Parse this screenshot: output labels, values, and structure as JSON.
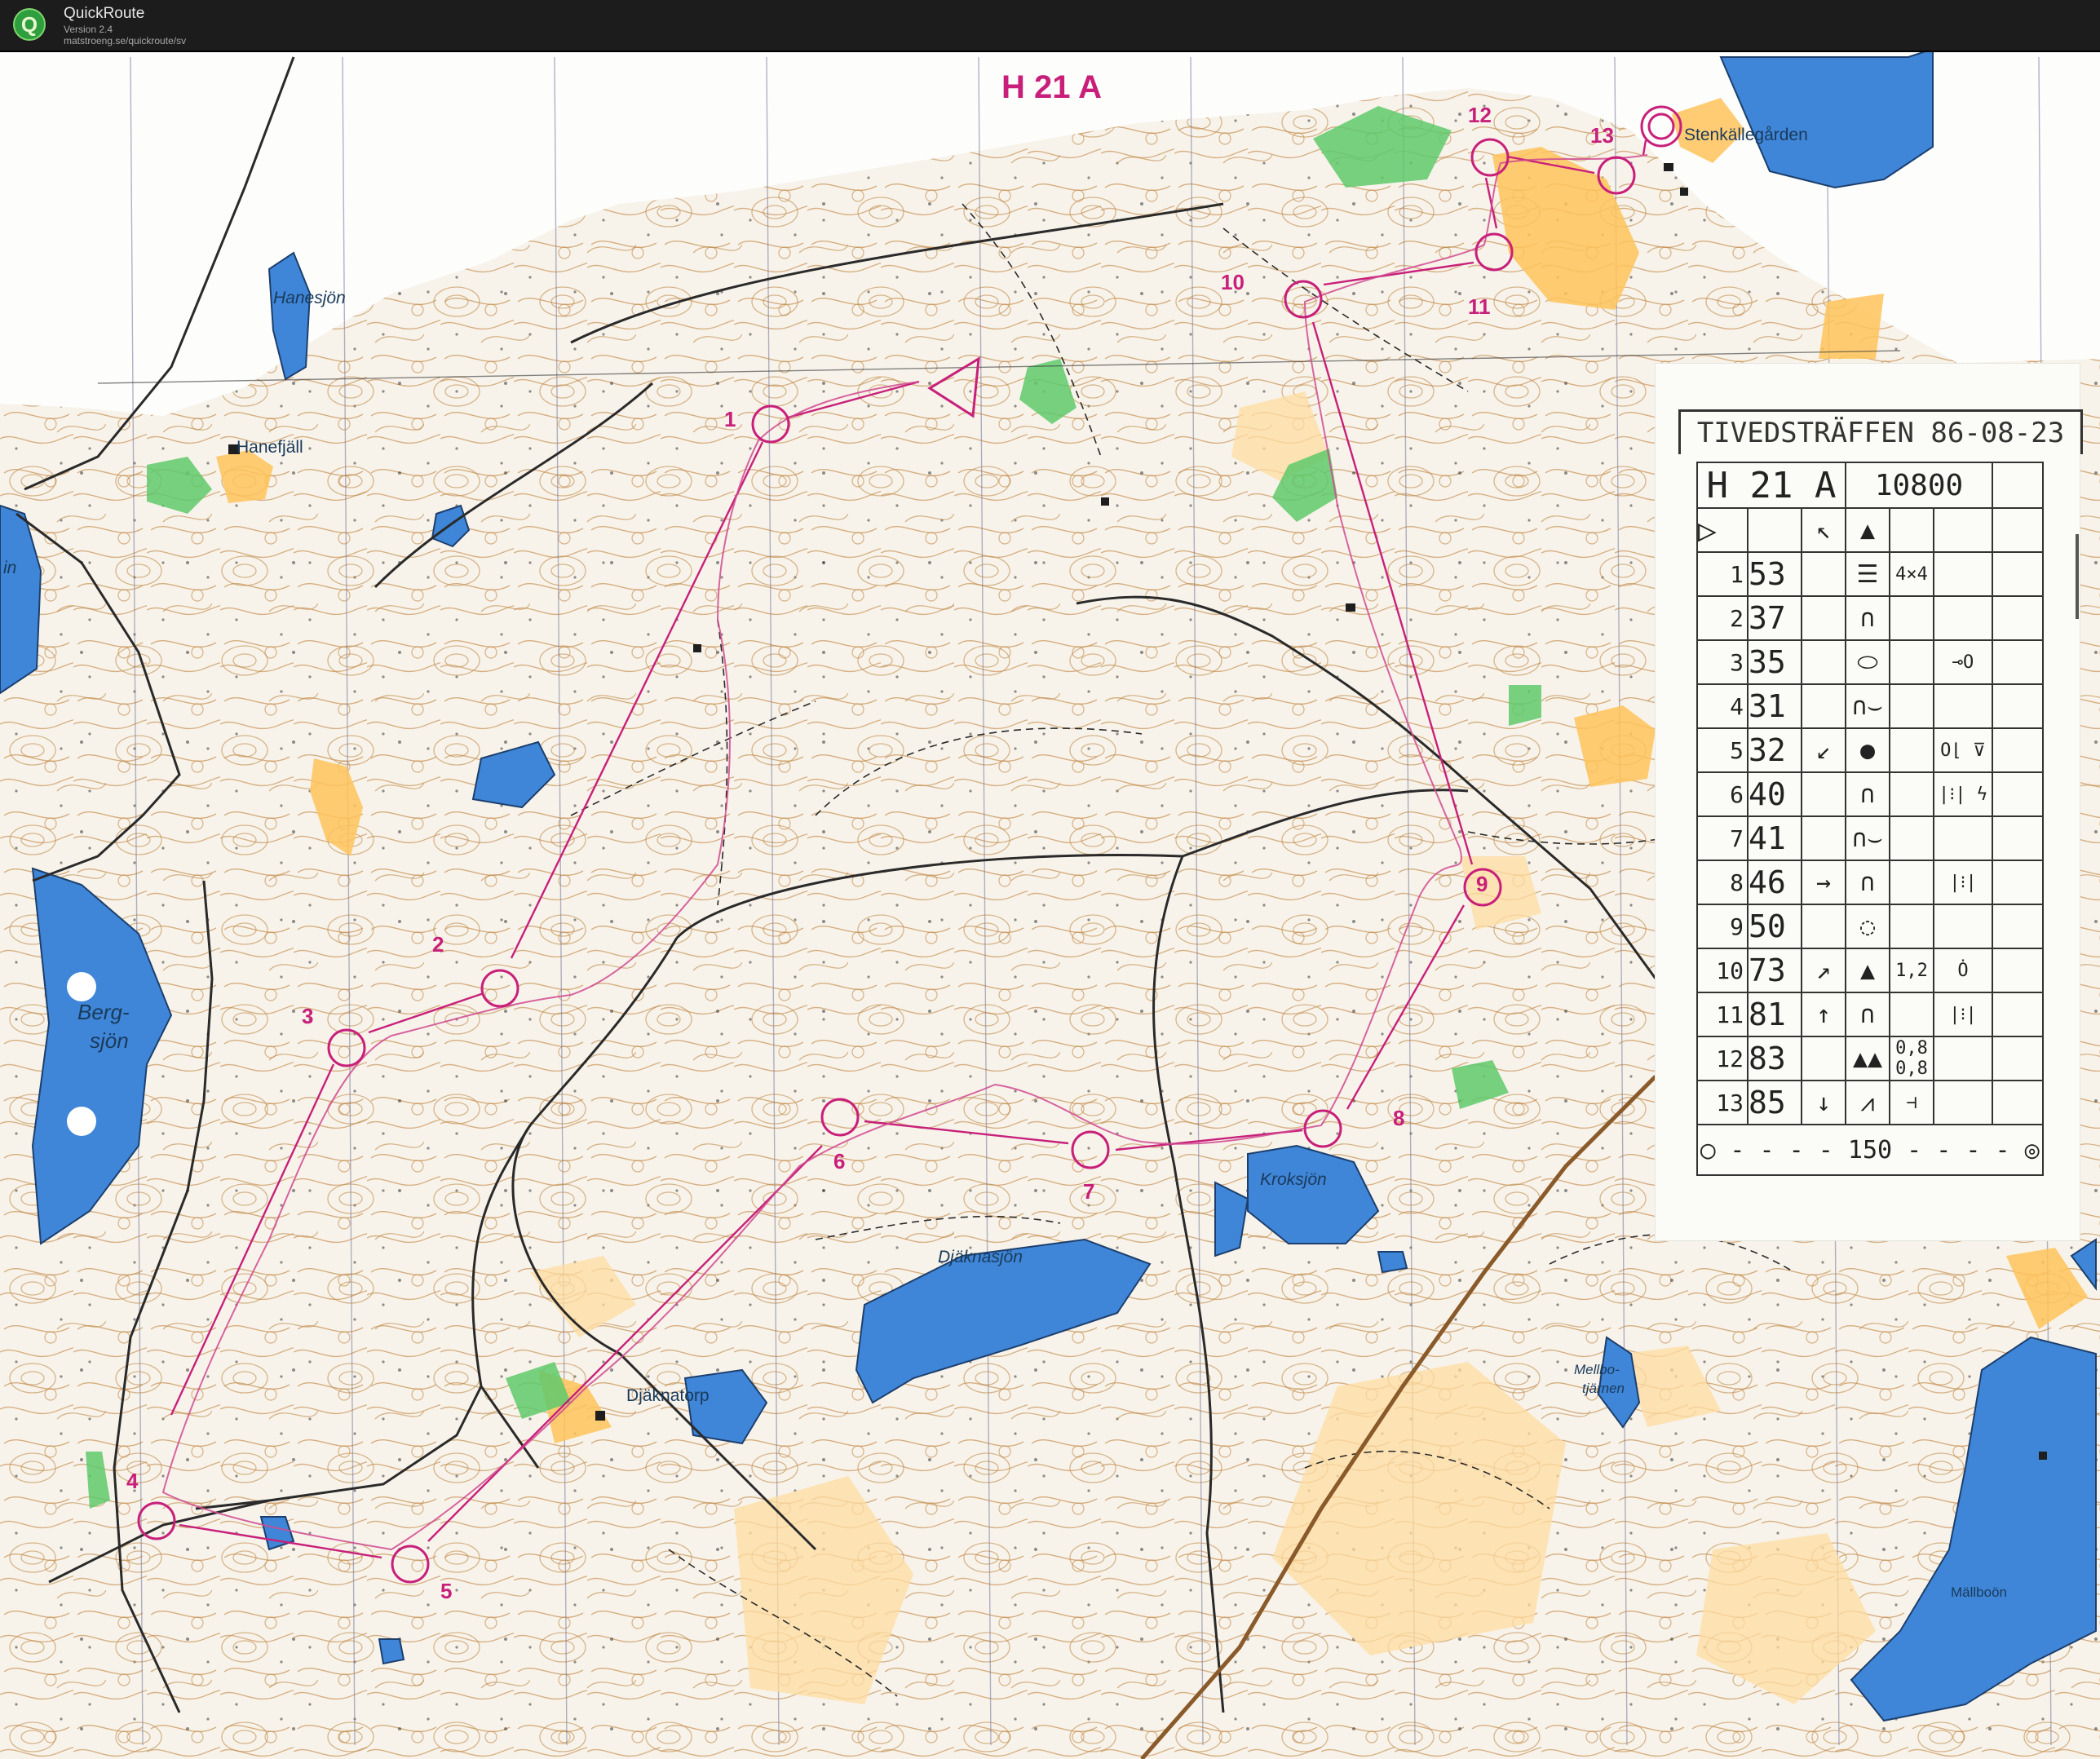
{
  "app": {
    "title": "QuickRoute",
    "version": "Version 2.4",
    "url": "matstroeng.se/quickroute/sv"
  },
  "map": {
    "course_title": "H 21 A",
    "place_names": {
      "hanesjon": "Hanesjön",
      "hanefjall": "Hanefjäll",
      "bergsjon_1": "Berg-",
      "bergsjon_2": "sjön",
      "in": "in",
      "stenkallegarden": "Stenkällegården",
      "kroksjon": "Kroksjön",
      "djaknasjon": "Djäknasjön",
      "djaknatorp": "Djäknatorp",
      "mellbotjarnen_1": "Mellbo-",
      "mellbotjarnen_2": "tjärnen",
      "mallboon": "Mällboön"
    },
    "controls": [
      "1",
      "2",
      "3",
      "4",
      "5",
      "6",
      "7",
      "8",
      "9",
      "10",
      "11",
      "12",
      "13"
    ]
  },
  "description_sheet": {
    "event_title": "TIVEDSTRÄFFEN 86-08-23",
    "course": "H 21 A",
    "distance": "10800",
    "start_symbols": [
      "▷",
      "↖",
      "▲"
    ],
    "rows": [
      {
        "n": "1",
        "code": "53",
        "dir": "",
        "feature": "☰",
        "extra": "4×4",
        "extra2": ""
      },
      {
        "n": "2",
        "code": "37",
        "dir": "",
        "feature": "∩",
        "extra": "",
        "extra2": ""
      },
      {
        "n": "3",
        "code": "35",
        "dir": "",
        "feature": "⬭",
        "extra": "",
        "extra2": "⊸O"
      },
      {
        "n": "4",
        "code": "31",
        "dir": "",
        "feature": "∩⌣",
        "extra": "",
        "extra2": ""
      },
      {
        "n": "5",
        "code": "32",
        "dir": "↙",
        "feature": "●",
        "extra": "",
        "extra2": "O⌊ ⊽"
      },
      {
        "n": "6",
        "code": "40",
        "dir": "",
        "feature": "∩",
        "extra": "",
        "extra2": "|⁝| ϟ"
      },
      {
        "n": "7",
        "code": "41",
        "dir": "",
        "feature": "∩⌣",
        "extra": "",
        "extra2": ""
      },
      {
        "n": "8",
        "code": "46",
        "dir": "→",
        "feature": "∩",
        "extra": "",
        "extra2": "|⁝|"
      },
      {
        "n": "9",
        "code": "50",
        "dir": "",
        "feature": "◌",
        "extra": "",
        "extra2": ""
      },
      {
        "n": "10",
        "code": "73",
        "dir": "↗",
        "feature": "▲",
        "extra": "1,2",
        "extra2": "Ȯ"
      },
      {
        "n": "11",
        "code": "81",
        "dir": "↑",
        "feature": "∩",
        "extra": "",
        "extra2": "|⁝|"
      },
      {
        "n": "12",
        "code": "83",
        "dir": "",
        "feature": "▲▲",
        "extra": "0,8 0,8",
        "extra2": ""
      },
      {
        "n": "13",
        "code": "85",
        "dir": "↓",
        "feature": "⩘",
        "extra": "⊣",
        "extra2": ""
      }
    ],
    "finish": "150"
  },
  "colors": {
    "titlebar": "#1c1c1c",
    "paper": "#f7f3ea",
    "water": "#3f86d8",
    "field": "#ffc35a",
    "green": "#5fc96b",
    "contour": "#c08a4a",
    "course": "#c8207a",
    "road": "#2a2a2a",
    "railway": "#8a5a2a"
  }
}
